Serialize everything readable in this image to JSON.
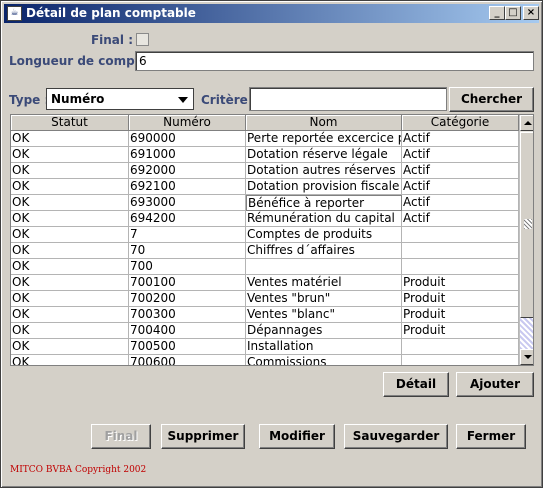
{
  "window": {
    "title": "Détail de plan comptable",
    "controls": [
      "_",
      "□",
      "×"
    ]
  },
  "form": {
    "final_label": "Final :",
    "final_checked": false,
    "length_label": "Longueur de compte :",
    "length_value": "6",
    "type_label": "Type :",
    "type_value": "Numéro",
    "criteria_label": "Critère :",
    "criteria_value": "",
    "search_button": "Chercher"
  },
  "table": {
    "columns": [
      "Statut",
      "Numéro",
      "Nom",
      "Catégorie"
    ],
    "rows": [
      [
        "OK",
        "690000",
        "Perte reportée excercice p...",
        "Actif"
      ],
      [
        "OK",
        "691000",
        "Dotation réserve légale",
        "Actif"
      ],
      [
        "OK",
        "692000",
        "Dotation autres réserves",
        "Actif"
      ],
      [
        "OK",
        "692100",
        "Dotation provision fiscale",
        "Actif"
      ],
      [
        "OK",
        "693000",
        "Bénéfice à reporter",
        "Actif"
      ],
      [
        "OK",
        "694200",
        "Rémunération du capital",
        "Actif"
      ],
      [
        "OK",
        "7",
        "Comptes de produits",
        ""
      ],
      [
        "OK",
        "70",
        "Chiffres d´affaires",
        ""
      ],
      [
        "OK",
        "700",
        "",
        ""
      ],
      [
        "OK",
        "700100",
        "Ventes matériel",
        "Produit"
      ],
      [
        "OK",
        "700200",
        "Ventes \"brun\"",
        "Produit"
      ],
      [
        "OK",
        "700300",
        "Ventes \"blanc\"",
        "Produit"
      ],
      [
        "OK",
        "700400",
        "Dépannages",
        "Produit"
      ],
      [
        "OK",
        "700500",
        "Installation",
        ""
      ],
      [
        "OK",
        "700600",
        "Commissions",
        ""
      ]
    ]
  },
  "buttons": {
    "detail": "Détail",
    "add": "Ajouter",
    "final": "Final",
    "delete": "Supprimer",
    "modify": "Modifier",
    "save": "Sauvegarder",
    "close": "Fermer"
  },
  "footer": {
    "copyright": "MITCO BVBA Copyright 2002"
  }
}
